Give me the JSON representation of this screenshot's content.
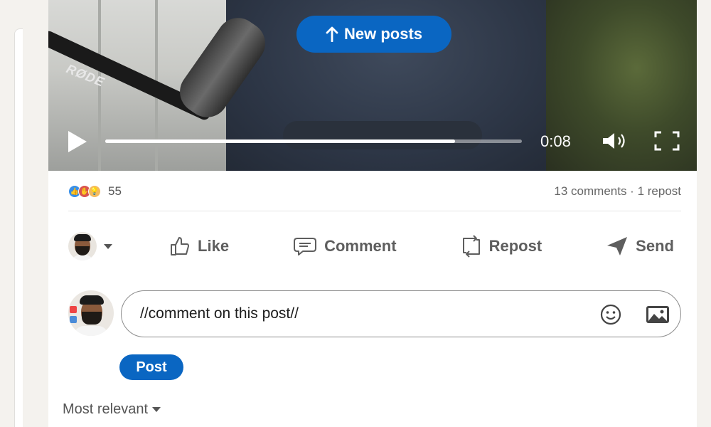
{
  "video": {
    "new_posts_label": "New posts",
    "time": "0:08",
    "progress": 0.84
  },
  "social": {
    "reaction_count": "55",
    "comments_reposts": "13 comments · 1 repost"
  },
  "actions": {
    "like": "Like",
    "comment": "Comment",
    "repost": "Repost",
    "send": "Send"
  },
  "composer": {
    "value": "//comment on this post//",
    "post_label": "Post"
  },
  "sort": {
    "label": "Most relevant"
  },
  "colors": {
    "accent": "#0a66c2",
    "like_reaction": "#378fe9",
    "celebrate_reaction": "#d9534f",
    "insight_reaction": "#f5bb5c"
  },
  "icons": [
    "up-arrow-icon",
    "play-icon",
    "volume-icon",
    "fullscreen-icon",
    "like-icon",
    "comment-icon",
    "repost-icon",
    "send-icon",
    "emoji-icon",
    "image-icon",
    "chevron-down-icon"
  ]
}
